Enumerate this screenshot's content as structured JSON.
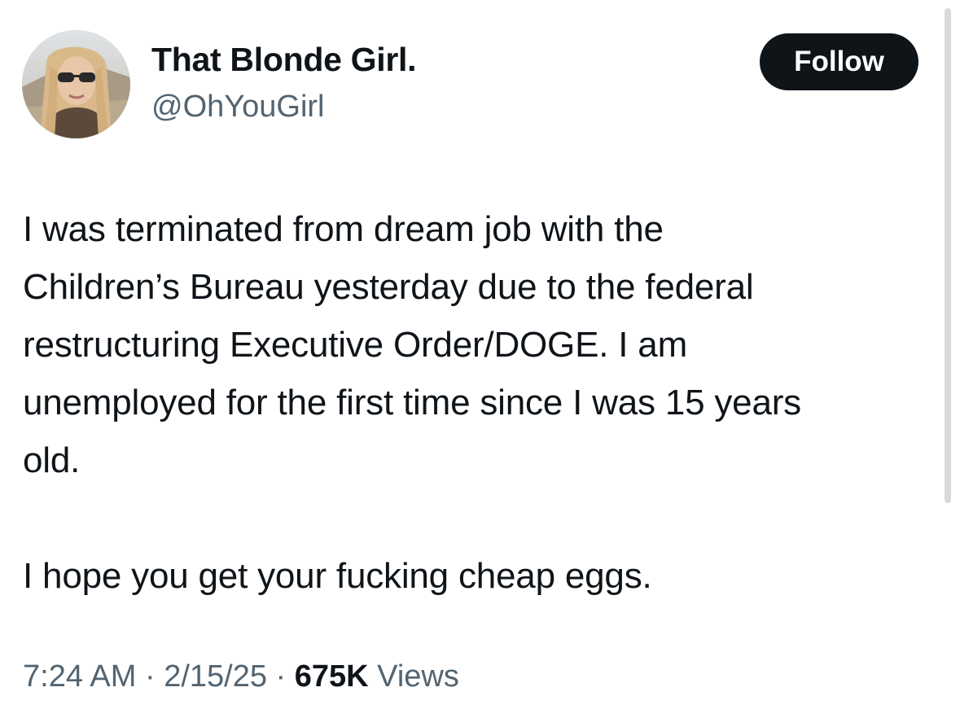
{
  "author": {
    "display_name": "That Blonde Girl.",
    "handle": "@OhYouGirl",
    "avatar_icon": "profile-photo"
  },
  "follow_button": {
    "label": "Follow"
  },
  "tweet": {
    "paragraphs": [
      "I was terminated from dream job with the\nChildren’s Bureau yesterday due to the federal\nrestructuring Executive Order/DOGE. I am\nunemployed for the first time since I was 15 years\nold.",
      "I hope you get your fucking cheap eggs."
    ]
  },
  "meta": {
    "time": "7:24 AM",
    "separator": " · ",
    "date": "2/15/25",
    "views_count": "675K",
    "views_label": " Views"
  },
  "colors": {
    "text_primary": "#0f1419",
    "text_secondary": "#536471",
    "button_bg": "#0f1419",
    "button_text": "#ffffff"
  }
}
